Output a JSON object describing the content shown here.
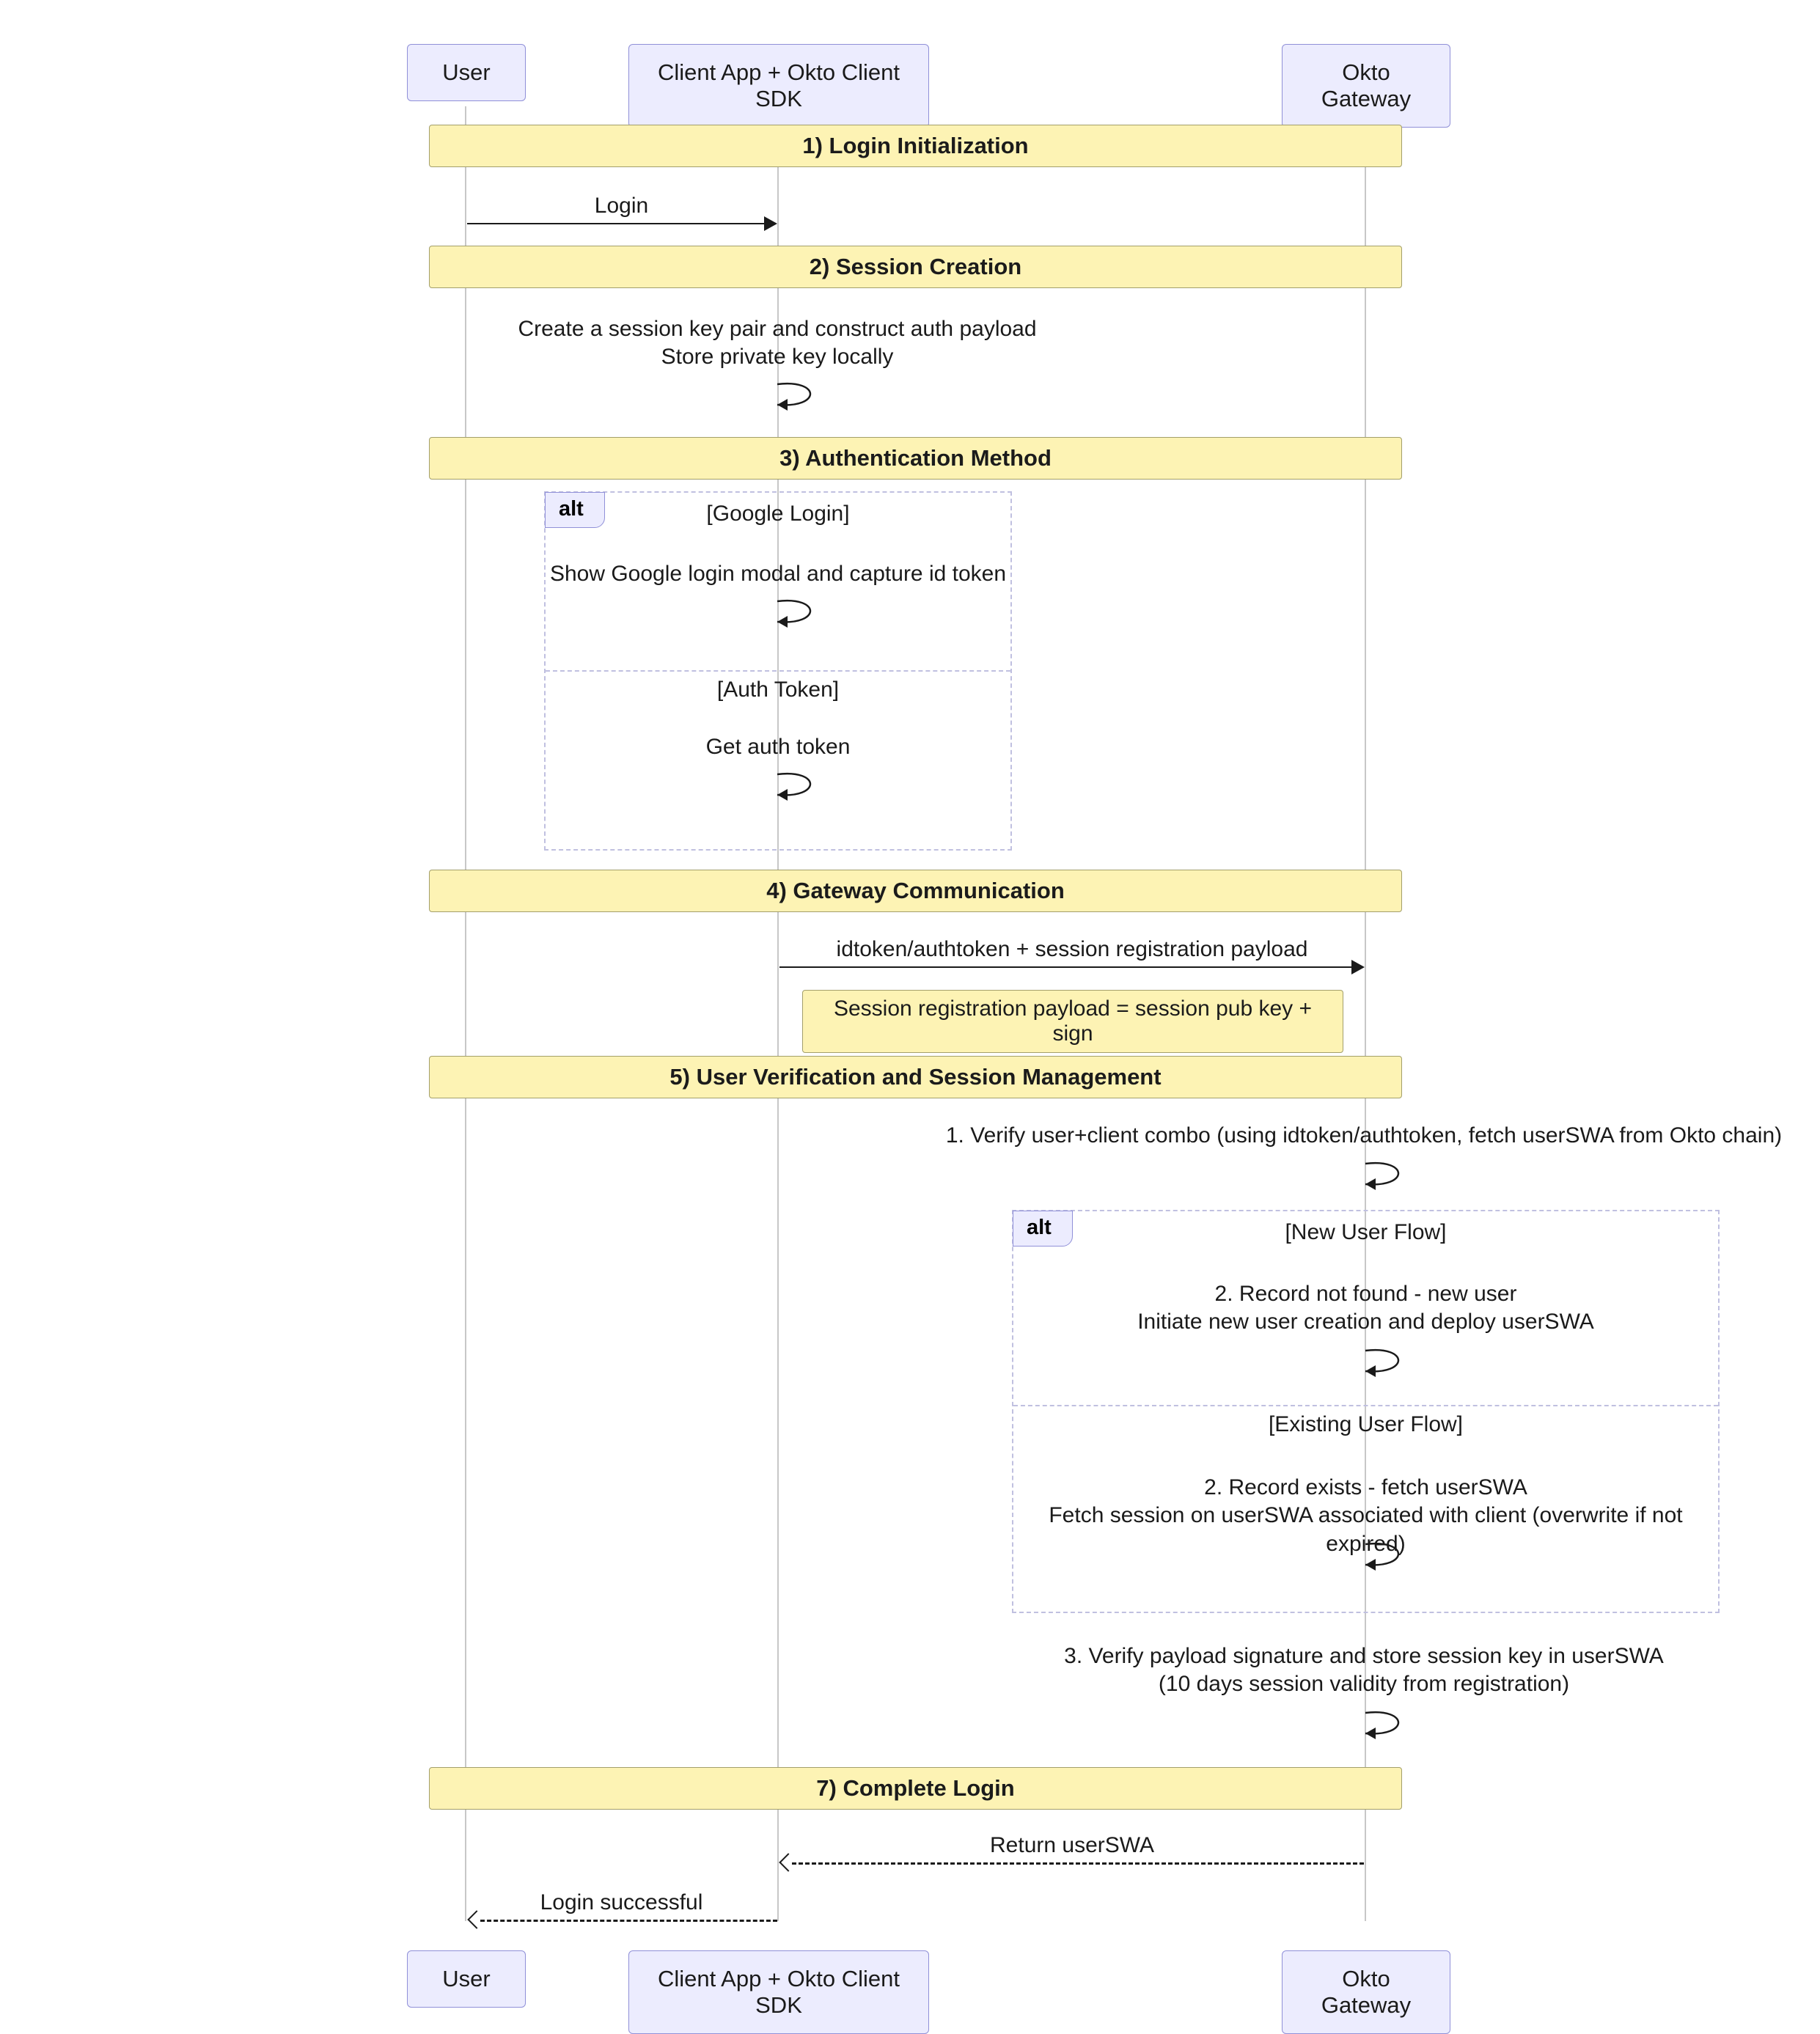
{
  "actors": {
    "user": "User",
    "client": "Client App + Okto Client SDK",
    "gateway": "Okto Gateway"
  },
  "phases": {
    "p1": "1) Login Initialization",
    "p2": "2) Session Creation",
    "p3": "3) Authentication Method",
    "p4": "4) Gateway Communication",
    "p5": "5) User Verification and Session Management",
    "p7": "7) Complete Login"
  },
  "msgs": {
    "login": "Login",
    "sessionCreate": "Create a session key pair and construct auth payload\nStore private key locally",
    "googleLogin": "Show Google login modal and capture id token",
    "authToken": "Get auth token",
    "gatewaySend": "idtoken/authtoken + session registration payload",
    "regNote": "Session registration payload = session pub key + sign",
    "verify1": "1. Verify user+client combo (using idtoken/authtoken, fetch userSWA from Okto chain)",
    "newUser": "2. Record not found - new user\nInitiate new user creation and deploy userSWA",
    "existingUser": "2. Record exists - fetch userSWA\nFetch session on userSWA associated with client (overwrite if not expired)",
    "verify3": "3. Verify payload signature and store session key in userSWA\n(10 days session validity from registration)",
    "returnSwa": "Return userSWA",
    "loginOk": "Login successful"
  },
  "alts": {
    "label": "alt",
    "auth_google": "[Google Login]",
    "auth_token": "[Auth Token]",
    "new_user": "[New User Flow]",
    "existing_user": "[Existing User Flow]"
  },
  "chart_data": {
    "type": "sequence_diagram",
    "actors": [
      "User",
      "Client App + Okto Client SDK",
      "Okto Gateway"
    ],
    "steps": [
      {
        "phase": "1) Login Initialization",
        "from": "User",
        "to": "Client App + Okto Client SDK",
        "label": "Login",
        "kind": "sync"
      },
      {
        "phase": "2) Session Creation",
        "from": "Client App + Okto Client SDK",
        "to": "Client App + Okto Client SDK",
        "label": "Create a session key pair and construct auth payload; Store private key locally",
        "kind": "self"
      },
      {
        "phase": "3) Authentication Method",
        "frame": "alt",
        "guards": [
          "[Google Login]",
          "[Auth Token]"
        ],
        "branches": [
          [
            {
              "from": "Client App + Okto Client SDK",
              "to": "Client App + Okto Client SDK",
              "label": "Show Google login modal and capture id token",
              "kind": "self"
            }
          ],
          [
            {
              "from": "Client App + Okto Client SDK",
              "to": "Client App + Okto Client SDK",
              "label": "Get auth token",
              "kind": "self"
            }
          ]
        ]
      },
      {
        "phase": "4) Gateway Communication",
        "from": "Client App + Okto Client SDK",
        "to": "Okto Gateway",
        "label": "idtoken/authtoken + session registration payload",
        "kind": "sync",
        "note": "Session registration payload = session pub key + sign"
      },
      {
        "phase": "5) User Verification and Session Management",
        "from": "Okto Gateway",
        "to": "Okto Gateway",
        "label": "1. Verify user+client combo (using idtoken/authtoken, fetch userSWA from Okto chain)",
        "kind": "self"
      },
      {
        "phase": "5) User Verification and Session Management",
        "frame": "alt",
        "guards": [
          "[New User Flow]",
          "[Existing User Flow]"
        ],
        "branches": [
          [
            {
              "from": "Okto Gateway",
              "to": "Okto Gateway",
              "label": "2. Record not found - new user; Initiate new user creation and deploy userSWA",
              "kind": "self"
            }
          ],
          [
            {
              "from": "Okto Gateway",
              "to": "Okto Gateway",
              "label": "2. Record exists - fetch userSWA; Fetch session on userSWA associated with client (overwrite if not expired)",
              "kind": "self"
            }
          ]
        ]
      },
      {
        "phase": "5) User Verification and Session Management",
        "from": "Okto Gateway",
        "to": "Okto Gateway",
        "label": "3. Verify payload signature and store session key in userSWA (10 days session validity from registration)",
        "kind": "self"
      },
      {
        "phase": "7) Complete Login",
        "from": "Okto Gateway",
        "to": "Client App + Okto Client SDK",
        "label": "Return userSWA",
        "kind": "return"
      },
      {
        "phase": "7) Complete Login",
        "from": "Client App + Okto Client SDK",
        "to": "User",
        "label": "Login successful",
        "kind": "return"
      }
    ]
  }
}
